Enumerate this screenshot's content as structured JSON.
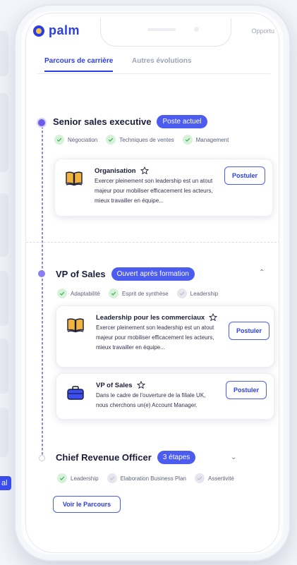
{
  "app": {
    "logo": "palm",
    "header_right": "Opportu"
  },
  "background": {
    "tag": "al"
  },
  "tabs": [
    {
      "label": "Parcours de carrière",
      "active": true
    },
    {
      "label": "Autres évolutions",
      "active": false
    }
  ],
  "steps": [
    {
      "title": "Senior sales executive",
      "badge": "Poste actuel",
      "skills": [
        {
          "label": "Négociation",
          "status": "validated"
        },
        {
          "label": "Techniques de ventes",
          "status": "validated"
        },
        {
          "label": "Management",
          "status": "validated"
        }
      ],
      "cards": [
        {
          "icon": "book-icon",
          "title": "Organisation",
          "text": "Exercer pleinement son leadership est un atout majeur pour mobiliser efficacement les acteurs, mieux travailler en équipe...",
          "button": "Postuler"
        }
      ]
    },
    {
      "title": "VP of Sales",
      "badge": "Ouvert après formation",
      "skills": [
        {
          "label": "Adaptabilité",
          "status": "validated"
        },
        {
          "label": "Esprit de synthèse",
          "status": "validated"
        },
        {
          "label": "Leadership",
          "status": "pending"
        }
      ],
      "cards": [
        {
          "icon": "book-icon",
          "title": "Leadership pour les commerciaux",
          "text": "Exercer pleinement son leadership est un atout majeur pour mobiliser efficacement les acteurs, mieux travailler en équipe...",
          "button": "Postuler"
        },
        {
          "icon": "briefcase-icon",
          "title": "VP of Sales",
          "text": "Dans le cadre de l'ouverture de la filiale UK, nous cherchons un(e) Account Manager.",
          "button": "Postuler"
        }
      ]
    },
    {
      "title": "Chief Revenue Officer",
      "badge": "3 étapes",
      "skills": [
        {
          "label": "Leadership",
          "status": "validated"
        },
        {
          "label": "Elaboration Business Plan",
          "status": "pending"
        },
        {
          "label": "Assertivité",
          "status": "pending"
        }
      ],
      "link": "Voir le Parcours"
    }
  ],
  "colors": {
    "accent": "#2b3de6",
    "pill": "#4c5cf0",
    "timeline": "#8a83f0",
    "check_bg": "#d6f3da"
  }
}
